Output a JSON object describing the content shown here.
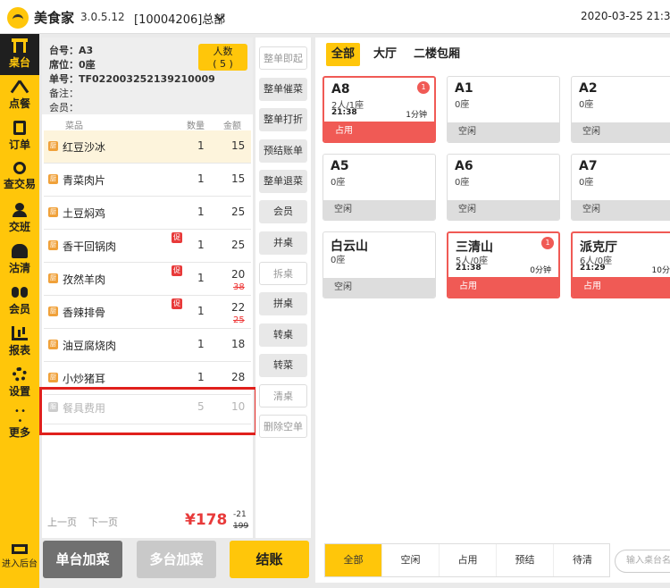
{
  "app": {
    "name": "美食家",
    "version": "3.0.5.12",
    "store": "[10004206]总部",
    "datetime": "2020-03-25 21:39:3"
  },
  "sidebar": {
    "items": [
      {
        "label": "桌台",
        "icon": "table-icon"
      },
      {
        "label": "点餐",
        "icon": "fork-knife-icon"
      },
      {
        "label": "订单",
        "icon": "document-icon"
      },
      {
        "label": "查交易",
        "icon": "search-doc-icon"
      },
      {
        "label": "交班",
        "icon": "user-icon"
      },
      {
        "label": "沽清",
        "icon": "bell-icon"
      },
      {
        "label": "会员",
        "icon": "users-icon"
      },
      {
        "label": "报表",
        "icon": "chart-icon"
      },
      {
        "label": "设置",
        "icon": "gear-icon"
      },
      {
        "label": "更多",
        "icon": "more-icon"
      }
    ],
    "backend": "进入后台"
  },
  "order": {
    "table_no": "台号：A3",
    "seats": "席位：0座",
    "order_no": "单号：TF022003252139210009",
    "remark": "备注：",
    "member": "会员：",
    "guest_label": "人数",
    "guest_count": "( 5 )",
    "col_dish": "菜品",
    "col_qty": "数量",
    "col_amount": "金额",
    "items": [
      {
        "icon": "厨",
        "name": "红豆沙冰",
        "qty": "1",
        "amount": "15",
        "orig": "",
        "promo": ""
      },
      {
        "icon": "厨",
        "name": "青菜肉片",
        "qty": "1",
        "amount": "15",
        "orig": "",
        "promo": ""
      },
      {
        "icon": "厨",
        "name": "土豆焖鸡",
        "qty": "1",
        "amount": "25",
        "orig": "",
        "promo": ""
      },
      {
        "icon": "厨",
        "name": "香干回锅肉",
        "qty": "1",
        "amount": "25",
        "orig": "",
        "promo": "促"
      },
      {
        "icon": "厨",
        "name": "孜然羊肉",
        "qty": "1",
        "amount": "20",
        "orig": "38",
        "promo": "促"
      },
      {
        "icon": "厨",
        "name": "香辣排骨",
        "qty": "1",
        "amount": "22",
        "orig": "25",
        "promo": "促"
      },
      {
        "icon": "厨",
        "name": "油豆腐烧肉",
        "qty": "1",
        "amount": "18",
        "orig": "",
        "promo": ""
      },
      {
        "icon": "厨",
        "name": "小炒猪耳",
        "qty": "1",
        "amount": "28",
        "orig": "",
        "promo": ""
      },
      {
        "icon": "服",
        "name": "餐具费用",
        "qty": "5",
        "amount": "10",
        "orig": "",
        "promo": ""
      }
    ],
    "prev_page": "上一页",
    "next_page": "下一页",
    "total": "¥178",
    "discount": "-21",
    "original_total": "199"
  },
  "actions": [
    "整单即起",
    "整单催菜",
    "整单打折",
    "预结账单",
    "整单退菜",
    "会员",
    "并桌",
    "拆桌",
    "拼桌",
    "转桌",
    "转菜",
    "清桌",
    "删除空单"
  ],
  "bottom_buttons": {
    "single_add": "单台加菜",
    "multi_add": "多台加菜",
    "checkout": "结账"
  },
  "tabs": [
    "全部",
    "大厅",
    "二楼包厢"
  ],
  "tables": [
    {
      "name": "A8",
      "seats": "2人/1座",
      "time": "21:38",
      "duration": "1分钟",
      "status": "占用",
      "badge": "1"
    },
    {
      "name": "A1",
      "seats": "0座",
      "time": "",
      "duration": "",
      "status": "空闲",
      "badge": ""
    },
    {
      "name": "A2",
      "seats": "0座",
      "time": "",
      "duration": "",
      "status": "空闲",
      "badge": ""
    },
    {
      "name": "A5",
      "seats": "0座",
      "time": "",
      "duration": "",
      "status": "空闲",
      "badge": ""
    },
    {
      "name": "A6",
      "seats": "0座",
      "time": "",
      "duration": "",
      "status": "空闲",
      "badge": ""
    },
    {
      "name": "A7",
      "seats": "0座",
      "time": "",
      "duration": "",
      "status": "空闲",
      "badge": ""
    },
    {
      "name": "白云山",
      "seats": "0座",
      "time": "",
      "duration": "",
      "status": "空闲",
      "badge": ""
    },
    {
      "name": "三清山",
      "seats": "5人/0座",
      "time": "21:38",
      "duration": "0分钟",
      "status": "占用",
      "badge": "1"
    },
    {
      "name": "派克厅",
      "seats": "6人/0座",
      "time": "21:29",
      "duration": "10分",
      "status": "占用",
      "badge": ""
    }
  ],
  "filters": [
    "全部",
    "空闲",
    "占用",
    "预结",
    "待清"
  ],
  "search_placeholder": "输入桌台名称",
  "colors": {
    "brand": "#ffc60a",
    "occupied": "#f05a55",
    "promo": "#e83a3a",
    "highlight_box": "#e0201c"
  }
}
